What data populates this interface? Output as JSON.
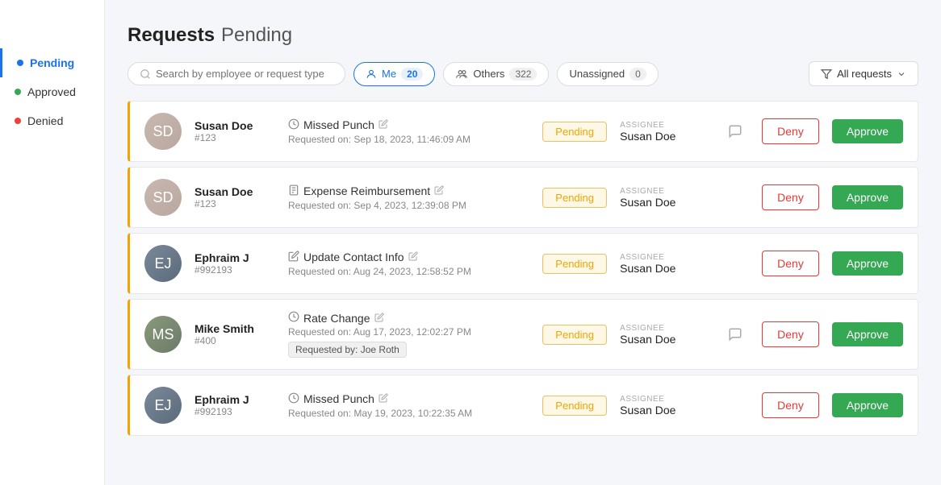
{
  "sidebar": {
    "items": [
      {
        "id": "pending",
        "label": "Pending",
        "dot": "blue",
        "active": true
      },
      {
        "id": "approved",
        "label": "Approved",
        "dot": "green",
        "active": false
      },
      {
        "id": "denied",
        "label": "Denied",
        "dot": "red",
        "active": false
      }
    ]
  },
  "header": {
    "title": "Requests",
    "status": "Pending"
  },
  "search": {
    "placeholder": "Search by employee or request type"
  },
  "filters": {
    "me_label": "Me",
    "me_count": "20",
    "others_label": "Others",
    "others_count": "322",
    "unassigned_label": "Unassigned",
    "unassigned_count": "0",
    "all_requests_label": "All requests"
  },
  "requests": [
    {
      "id": 1,
      "employee_name": "Susan Doe",
      "employee_id": "#123",
      "avatar_initials": "SD",
      "avatar_class": "avatar-susan",
      "request_type": "Missed Punch",
      "type_icon": "clock",
      "requested_on": "Requested on: Sep 18, 2023, 11:46:09 AM",
      "status": "Pending",
      "assignee_label": "ASSIGNEE",
      "assignee_name": "Susan Doe",
      "has_comment": true,
      "requested_by": null
    },
    {
      "id": 2,
      "employee_name": "Susan Doe",
      "employee_id": "#123",
      "avatar_initials": "SD",
      "avatar_class": "avatar-susan",
      "request_type": "Expense Reimbursement",
      "type_icon": "document",
      "requested_on": "Requested on: Sep 4, 2023, 12:39:08 PM",
      "status": "Pending",
      "assignee_label": "ASSIGNEE",
      "assignee_name": "Susan Doe",
      "has_comment": false,
      "requested_by": null
    },
    {
      "id": 3,
      "employee_name": "Ephraim J",
      "employee_id": "#992193",
      "avatar_initials": "EJ",
      "avatar_class": "avatar-ephraim",
      "request_type": "Update Contact Info",
      "type_icon": "pencil",
      "requested_on": "Requested on: Aug 24, 2023, 12:58:52 PM",
      "status": "Pending",
      "assignee_label": "ASSIGNEE",
      "assignee_name": "Susan Doe",
      "has_comment": false,
      "requested_by": null
    },
    {
      "id": 4,
      "employee_name": "Mike Smith",
      "employee_id": "#400",
      "avatar_initials": "MS",
      "avatar_class": "avatar-mike",
      "request_type": "Rate Change",
      "type_icon": "clock",
      "requested_on": "Requested on: Aug 17, 2023, 12:02:27 PM",
      "status": "Pending",
      "assignee_label": "ASSIGNEE",
      "assignee_name": "Susan Doe",
      "has_comment": true,
      "requested_by": "Requested by: Joe Roth"
    },
    {
      "id": 5,
      "employee_name": "Ephraim J",
      "employee_id": "#992193",
      "avatar_initials": "EJ",
      "avatar_class": "avatar-ephraim",
      "request_type": "Missed Punch",
      "type_icon": "clock",
      "requested_on": "Requested on: May 19, 2023, 10:22:35 AM",
      "status": "Pending",
      "assignee_label": "ASSIGNEE",
      "assignee_name": "Susan Doe",
      "has_comment": false,
      "requested_by": null
    }
  ],
  "buttons": {
    "deny": "Deny",
    "approve": "Approve"
  }
}
